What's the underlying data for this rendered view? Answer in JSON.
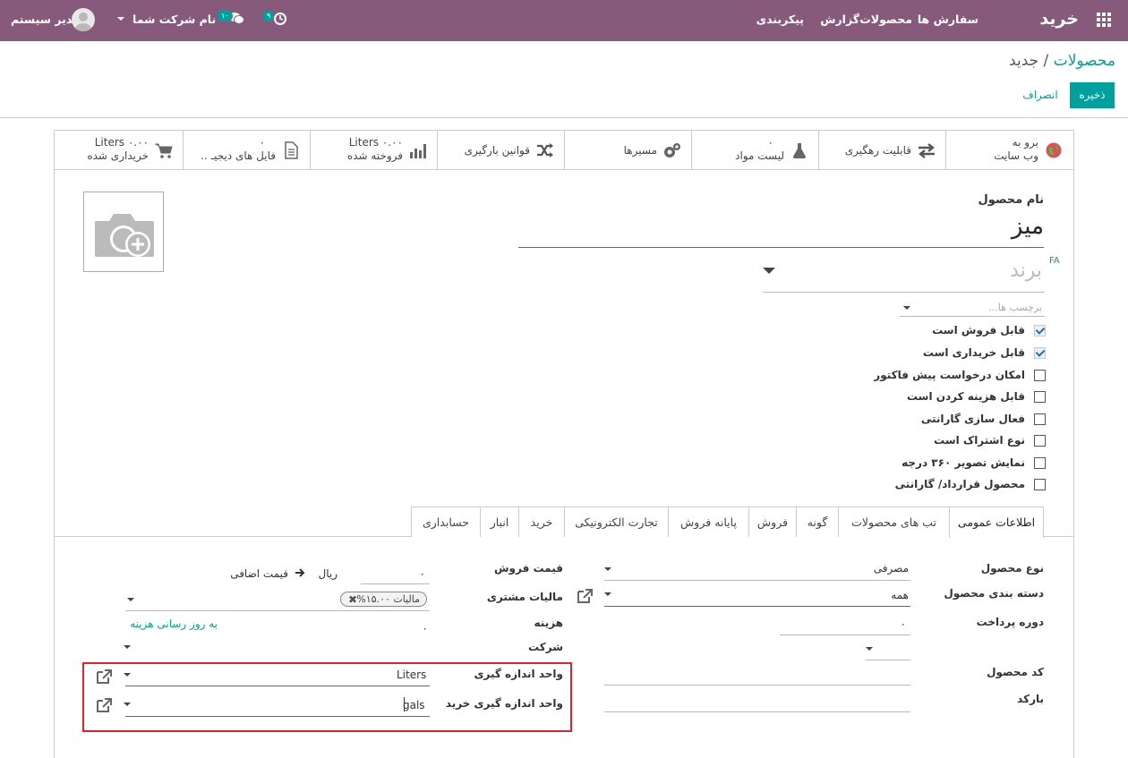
{
  "navbar": {
    "app_title": "خرید",
    "menu": [
      "سفارش ها",
      "محصولات",
      "گزارش",
      "پیکربندی"
    ],
    "user_name": "مدیر سیستم",
    "company_name": "نام شرکت شما",
    "messages_count": "۱۰",
    "activities_count": "۹",
    "bg_color": "#875a7b",
    "badge_color": "#00a09d"
  },
  "breadcrumb": {
    "parent": "محصولات",
    "separator": "/",
    "current": "جدید"
  },
  "actions": {
    "save": "ذخیره",
    "discard": "انصراف"
  },
  "smart_buttons": [
    {
      "line1": "برو به",
      "line2": "وب سایت",
      "icon": "globe-icon"
    },
    {
      "line1": "قابلیت رهگیری",
      "icon": "exchange-icon"
    },
    {
      "line1": "۰",
      "line2": "لیست مواد",
      "icon": "flask-icon"
    },
    {
      "line1": "مسیرها",
      "icon": "cogs-icon"
    },
    {
      "line1": "قوانین بارگیری",
      "icon": "shuffle-icon"
    },
    {
      "line1": "Liters ۰.۰۰",
      "line2": "فروخته شده",
      "icon": "bar-chart-icon"
    },
    {
      "line1": "۰",
      "line2": "فایل های دیجیـ ..",
      "icon": "file-icon"
    },
    {
      "line1": "Liters ۰.۰۰",
      "line2": "خریداری شده",
      "icon": "cart-icon"
    }
  ],
  "product": {
    "name_label": "نام محصول",
    "name": "میز",
    "lang": "FA",
    "brand_placeholder": "برند",
    "tags_placeholder": "برچسب ها..."
  },
  "checkboxes": [
    {
      "label": "قابل فروش است",
      "checked": true
    },
    {
      "label": "قابل خریداری است",
      "checked": true
    },
    {
      "label": "امکان درخواست پیش فاکتور",
      "checked": false
    },
    {
      "label": "قابل هزینه کردن است",
      "checked": false
    },
    {
      "label": "فعال سازی گارانتی",
      "checked": false
    },
    {
      "label": "نوع اشتراک است",
      "checked": false
    },
    {
      "label": "نمایش تصویر ۳۶۰ درجه",
      "checked": false
    },
    {
      "label": "محصول قرارداد/ گارانتی",
      "checked": false
    }
  ],
  "tabs": [
    "اطلاعات عمومی",
    "تب های محصولات",
    "گونه",
    "فروش",
    "پایانه فروش",
    "تجارت الکترونیکی",
    "خرید",
    "انبار",
    "حسابداری"
  ],
  "right_fields": {
    "type_label": "نوع محصول",
    "type_value": "مصرفی",
    "category_label": "دسته بندی محصول",
    "category_value": "همه",
    "payment_label": "دوره پرداخت",
    "payment_value": "۰",
    "code_label": "کد محصول",
    "barcode_label": "بارکد"
  },
  "left_fields": {
    "price_label": "قیمت فروش",
    "price_value": "۰",
    "currency": "ریال",
    "extra_price": "قیمت اضافی",
    "tax_label": "مالیات مشتری",
    "tax_tag": "مالیات ۱۵.۰۰%",
    "cost_label": "هزینه",
    "cost_value": "۰",
    "update_cost": "به روز رسانی هزینه",
    "company_label": "شرکت",
    "uom_label": "واحد اندازه گیری",
    "uom_value": "Liters",
    "po_uom_label": "واحد اندازه گیری خرید",
    "po_uom_value": "gals"
  }
}
